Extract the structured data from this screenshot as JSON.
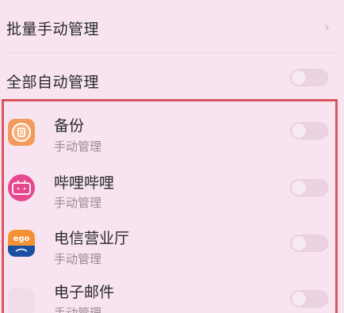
{
  "batch_manual": {
    "label": "批量手动管理",
    "chevron": "›"
  },
  "all_auto": {
    "label": "全部自动管理",
    "toggle_on": false
  },
  "apps": [
    {
      "name": "备份",
      "mode": "手动管理",
      "icon": "backup-app-icon",
      "toggle_on": false
    },
    {
      "name": "哔哩哔哩",
      "mode": "手动管理",
      "icon": "bilibili-app-icon",
      "toggle_on": false
    },
    {
      "name": "电信营业厅",
      "mode": "手动管理",
      "icon": "telecom-app-icon",
      "toggle_on": false
    },
    {
      "name": "电子邮件",
      "mode": "手动管理",
      "icon": "email-app-icon",
      "toggle_on": false
    }
  ],
  "colors": {
    "background": "#f7e4f0",
    "highlight": "#d9555e",
    "toggle_off": "#ecd3e1"
  }
}
